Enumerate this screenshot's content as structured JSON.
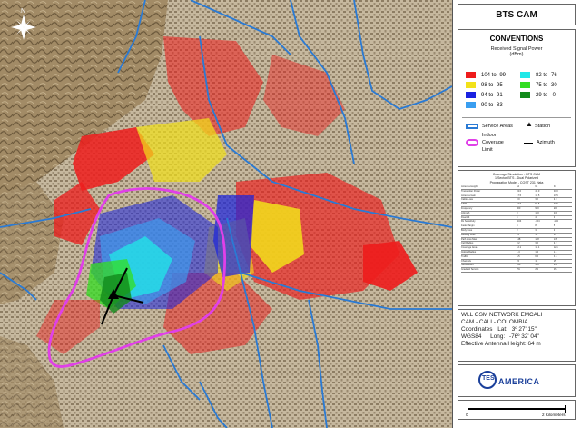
{
  "map": {
    "compass_label": "N"
  },
  "legend": {
    "title": "BTS CAM",
    "conventions_title": "CONVENTIONS",
    "signal_title_line1": "Received Signal Power",
    "signal_title_line2": "(dBm)",
    "signal_classes": [
      {
        "label": "-104 to -99",
        "color": "#ee1c1c"
      },
      {
        "label": "-98 to -95",
        "color": "#f2e11a"
      },
      {
        "label": "-94 to -91",
        "color": "#1a22e0"
      },
      {
        "label": "-90 to -83",
        "color": "#3a9ef0"
      },
      {
        "label": "-82 to -76",
        "color": "#20e8e8"
      },
      {
        "label": "-75 to -30",
        "color": "#33dd22"
      },
      {
        "label": "-29 to - 0",
        "color": "#118a1a"
      }
    ],
    "service_areas_label": "Service Areas",
    "station_label": "Station",
    "indoor_label_line1": "Indoor",
    "indoor_label_line2": "Coverage",
    "indoor_label_line3": "Limit",
    "azimuth_label": "Azimuth",
    "service_area_color": "#2a7ad4",
    "indoor_color": "#e040e8"
  },
  "table": {
    "header_line1": "Coverage Simulation - BTS CAM",
    "header_line2": "1 Sector BTS - Dual Polarized",
    "header_line3": "Propagation Model - COST 231 Hata",
    "rows": [
      [
        "Antenna Height",
        "64",
        "64",
        "64"
      ],
      [
        "Transmitter Power",
        "43.0",
        "43.0",
        "43.0"
      ],
      [
        "Antenna Gain",
        "17.5",
        "17.5",
        "17.5"
      ],
      [
        "Cable Loss",
        "3.0",
        "3.0",
        "3.0"
      ],
      [
        "EIRP",
        "57.5",
        "57.5",
        "57.5"
      ],
      [
        "Frequency",
        "900",
        "900",
        "900"
      ],
      [
        "Azimuth",
        "0",
        "120",
        "240"
      ],
      [
        "Downtilt",
        "4",
        "4",
        "4"
      ],
      [
        "Rx Sensitivity",
        "-104",
        "-104",
        "-104"
      ],
      [
        "Fade Margin",
        "8",
        "8",
        "8"
      ],
      [
        "Body Loss",
        "3",
        "3",
        "3"
      ],
      [
        "Building Loss",
        "15",
        "15",
        "15"
      ],
      [
        "Path Loss Max",
        "148",
        "148",
        "148"
      ],
      [
        "Cell Radius",
        "3.2",
        "3.2",
        "3.2"
      ],
      [
        "Coverage Area",
        "12.1",
        "12.1",
        "12.1"
      ],
      [
        "Indoor Radius",
        "1.4",
        "1.4",
        "1.4"
      ],
      [
        "Traffic",
        "6.5",
        "6.5",
        "6.5"
      ],
      [
        "Channels",
        "15",
        "15",
        "15"
      ],
      [
        "Subscribers",
        "350",
        "350",
        "350"
      ],
      [
        "Grade of Service",
        "2%",
        "2%",
        "2%"
      ]
    ]
  },
  "info": {
    "line1": "WLL GSM NETWORK EMCALI",
    "line2": "CAM - CALI - COLOMBIA",
    "coord_label": "Coordinates",
    "lat_label": "Lat:",
    "lat_value": "3º 27' 15\"",
    "datum": "WGS84",
    "long_label": "Long:",
    "long_value": "-76º 32' 04\"",
    "height_label": "Effective Antenna Height:",
    "height_value": "64 m"
  },
  "logo": {
    "text_left": "TES",
    "text_right": "AMERICA",
    "color": "#1a3f9a"
  },
  "scale": {
    "left_label": "0",
    "right_label": "2 Kilometers"
  }
}
